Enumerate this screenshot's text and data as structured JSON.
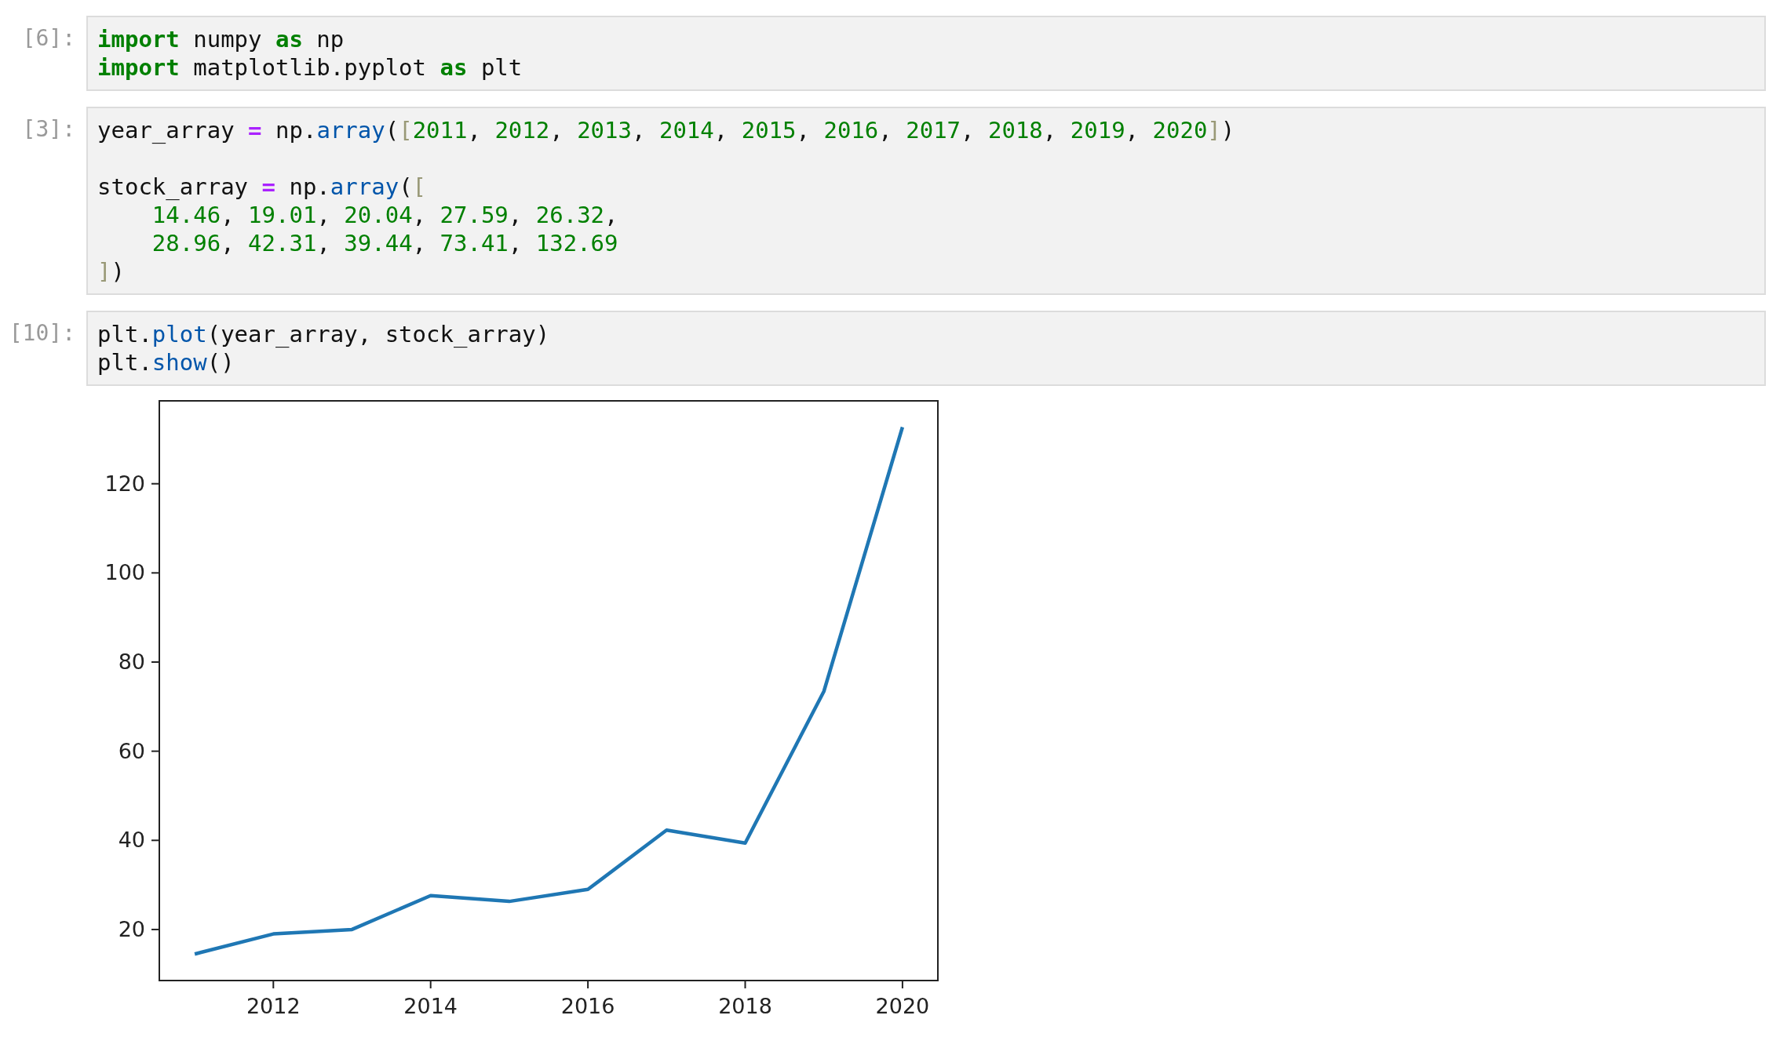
{
  "cells": [
    {
      "prompt": "[6]:",
      "lines": [
        {
          "tokens": [
            {
              "kind": "keyword",
              "text": "import"
            },
            {
              "kind": "plain",
              "text": " numpy "
            },
            {
              "kind": "keyword",
              "text": "as"
            },
            {
              "kind": "plain",
              "text": " np"
            }
          ]
        },
        {
          "tokens": [
            {
              "kind": "keyword",
              "text": "import"
            },
            {
              "kind": "plain",
              "text": " matplotlib.pyplot "
            },
            {
              "kind": "keyword",
              "text": "as"
            },
            {
              "kind": "plain",
              "text": " plt"
            }
          ]
        }
      ]
    },
    {
      "prompt": "[3]:",
      "lines": [
        {
          "blank_after": true,
          "tokens": [
            {
              "kind": "plain",
              "text": "year_array "
            },
            {
              "kind": "operator",
              "text": "="
            },
            {
              "kind": "plain",
              "text": " np."
            },
            {
              "kind": "function",
              "text": "array"
            },
            {
              "kind": "plain",
              "text": "("
            },
            {
              "kind": "bracket",
              "text": "["
            },
            {
              "kind": "number",
              "text": "2011"
            },
            {
              "kind": "plain",
              "text": ", "
            },
            {
              "kind": "number",
              "text": "2012"
            },
            {
              "kind": "plain",
              "text": ", "
            },
            {
              "kind": "number",
              "text": "2013"
            },
            {
              "kind": "plain",
              "text": ", "
            },
            {
              "kind": "number",
              "text": "2014"
            },
            {
              "kind": "plain",
              "text": ", "
            },
            {
              "kind": "number",
              "text": "2015"
            },
            {
              "kind": "plain",
              "text": ", "
            },
            {
              "kind": "number",
              "text": "2016"
            },
            {
              "kind": "plain",
              "text": ", "
            },
            {
              "kind": "number",
              "text": "2017"
            },
            {
              "kind": "plain",
              "text": ", "
            },
            {
              "kind": "number",
              "text": "2018"
            },
            {
              "kind": "plain",
              "text": ", "
            },
            {
              "kind": "number",
              "text": "2019"
            },
            {
              "kind": "plain",
              "text": ", "
            },
            {
              "kind": "number",
              "text": "2020"
            },
            {
              "kind": "bracket",
              "text": "]"
            },
            {
              "kind": "plain",
              "text": ")"
            }
          ]
        },
        {
          "tokens": [
            {
              "kind": "plain",
              "text": "stock_array "
            },
            {
              "kind": "operator",
              "text": "="
            },
            {
              "kind": "plain",
              "text": " np."
            },
            {
              "kind": "function",
              "text": "array"
            },
            {
              "kind": "plain",
              "text": "("
            },
            {
              "kind": "bracket",
              "text": "["
            }
          ]
        },
        {
          "indent": true,
          "tokens": [
            {
              "kind": "number",
              "text": "14.46"
            },
            {
              "kind": "plain",
              "text": ", "
            },
            {
              "kind": "number",
              "text": "19.01"
            },
            {
              "kind": "plain",
              "text": ", "
            },
            {
              "kind": "number",
              "text": "20.04"
            },
            {
              "kind": "plain",
              "text": ", "
            },
            {
              "kind": "number",
              "text": "27.59"
            },
            {
              "kind": "plain",
              "text": ", "
            },
            {
              "kind": "number",
              "text": "26.32"
            },
            {
              "kind": "plain",
              "text": ","
            }
          ]
        },
        {
          "indent": true,
          "tokens": [
            {
              "kind": "number",
              "text": "28.96"
            },
            {
              "kind": "plain",
              "text": ", "
            },
            {
              "kind": "number",
              "text": "42.31"
            },
            {
              "kind": "plain",
              "text": ", "
            },
            {
              "kind": "number",
              "text": "39.44"
            },
            {
              "kind": "plain",
              "text": ", "
            },
            {
              "kind": "number",
              "text": "73.41"
            },
            {
              "kind": "plain",
              "text": ", "
            },
            {
              "kind": "number",
              "text": "132.69"
            }
          ]
        },
        {
          "tokens": [
            {
              "kind": "bracket",
              "text": "]"
            },
            {
              "kind": "plain",
              "text": ")"
            }
          ]
        }
      ]
    },
    {
      "prompt": "[10]:",
      "lines": [
        {
          "tokens": [
            {
              "kind": "plain",
              "text": "plt."
            },
            {
              "kind": "function",
              "text": "plot"
            },
            {
              "kind": "plain",
              "text": "(year_array, stock_array)"
            }
          ]
        },
        {
          "tokens": [
            {
              "kind": "plain",
              "text": "plt."
            },
            {
              "kind": "function",
              "text": "show"
            },
            {
              "kind": "plain",
              "text": "()"
            }
          ]
        }
      ],
      "output": {
        "chart_data": {
          "type": "line",
          "x": [
            2011,
            2012,
            2013,
            2014,
            2015,
            2016,
            2017,
            2018,
            2019,
            2020
          ],
          "series": [
            {
              "color": "#1f77b4",
              "values": [
                14.5,
                19,
                20,
                27.6,
                26.3,
                29,
                42.3,
                39.4,
                73.4,
                132.7
              ]
            }
          ],
          "xlim": [
            2010.55,
            2020.45
          ],
          "ylim": [
            8.55,
            138.6
          ],
          "xticks": [
            2012,
            2014,
            2016,
            2018,
            2020
          ],
          "yticks": [
            20,
            40,
            60,
            80,
            100,
            120
          ]
        }
      }
    }
  ]
}
